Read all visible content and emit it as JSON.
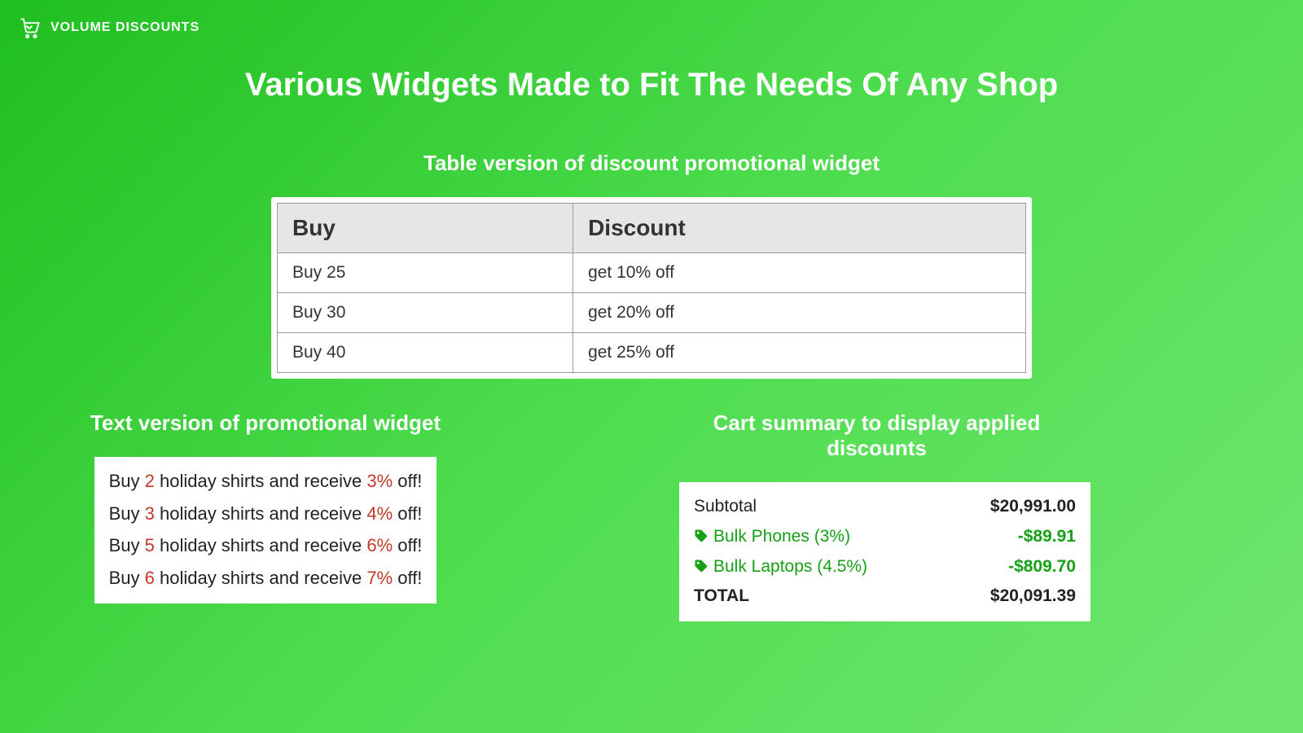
{
  "brand": {
    "name": "VOLUME DISCOUNTS"
  },
  "hero": {
    "title": "Various Widgets Made to Fit The Needs Of Any Shop"
  },
  "table_widget": {
    "heading": "Table version of discount promotional widget",
    "columns": {
      "buy": "Buy",
      "discount": "Discount"
    },
    "rows": [
      {
        "buy": "Buy 25",
        "discount": "get 10% off"
      },
      {
        "buy": "Buy 30",
        "discount": "get 20% off"
      },
      {
        "buy": "Buy 40",
        "discount": "get 25% off"
      }
    ]
  },
  "text_widget": {
    "heading": "Text version of promotional widget",
    "lines": [
      {
        "p1": "Buy ",
        "qty": "2",
        "p2": " holiday shirts and receive ",
        "pct": "3%",
        "p3": " off!"
      },
      {
        "p1": "Buy ",
        "qty": "3",
        "p2": " holiday shirts and receive ",
        "pct": "4%",
        "p3": " off!"
      },
      {
        "p1": "Buy ",
        "qty": "5",
        "p2": " holiday shirts and receive ",
        "pct": "6%",
        "p3": " off!"
      },
      {
        "p1": "Buy ",
        "qty": "6",
        "p2": " holiday shirts and receive ",
        "pct": "7%",
        "p3": " off!"
      }
    ]
  },
  "cart_widget": {
    "heading": "Cart summary to display applied discounts",
    "subtotal_label": "Subtotal",
    "subtotal_value": "$20,991.00",
    "discounts": [
      {
        "label": "Bulk Phones (3%)",
        "value": "-$89.91"
      },
      {
        "label": "Bulk Laptops (4.5%)",
        "value": "-$809.70"
      }
    ],
    "total_label": "TOTAL",
    "total_value": "$20,091.39"
  }
}
